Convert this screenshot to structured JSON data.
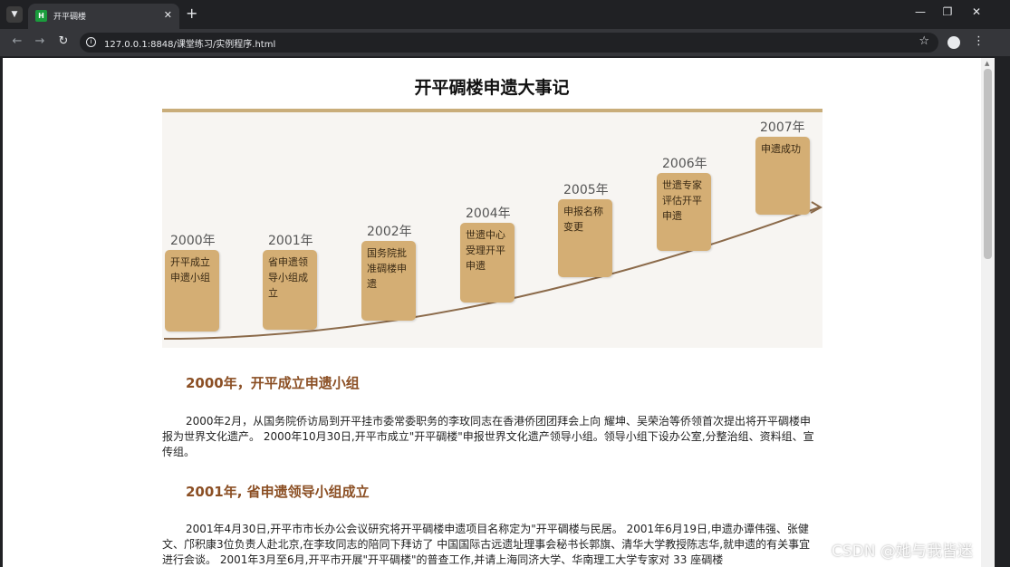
{
  "browser": {
    "tab_title": "开平碉楼",
    "favicon_letter": "H",
    "url": "127.0.0.1:8848/课堂练习/实例程序.html"
  },
  "page": {
    "title": "开平碉楼申遗大事记",
    "timeline": {
      "milestones": [
        {
          "year": "2000年",
          "text": "开平成立申遗小组"
        },
        {
          "year": "2001年",
          "text": "省申遗领导小组成立"
        },
        {
          "year": "2002年",
          "text": "国务院批准碉楼申遗"
        },
        {
          "year": "2004年",
          "text": "世遗中心受理开平申遗"
        },
        {
          "year": "2005年",
          "text": "申报名称变更"
        },
        {
          "year": "2006年",
          "text": "世遗专家评估开平申遗"
        },
        {
          "year": "2007年",
          "text": "申遗成功"
        }
      ]
    },
    "sections": [
      {
        "heading": "2000年，开平成立申遗小组",
        "body": "2000年2月，从国务院侨访局到开平挂市委常委职务的李玫同志在香港侨团团拜会上向 耀坤、吴荣治等侨领首次提出将开平碉楼申报为世界文化遗产。 2000年10月30日,开平市成立\"开平碉楼\"申报世界文化遗产领导小组。领导小组下设办公室,分整治组、资料组、宣传组。"
      },
      {
        "heading": "2001年, 省申遗领导小组成立",
        "body": "2001年4月30日,开平市市长办公会议研究将开平碉楼申遗项目名称定为\"开平碉楼与民居。 2001年6月19日,申遗办谭伟强、张健文、邝积康3位负责人赴北京,在李玫同志的陪同下拜访了 中国国际古远遗址理事会秘书长郭旗、清华大学教授陈志华,就申遗的有关事宜进行会谈。 2001年3月至6月,开平市开展\"开平碉楼\"的普查工作,并请上海同济大学、华南理工大学专家对 33 座碉楼"
      }
    ]
  },
  "watermark": "CSDN @她与我皆迷"
}
